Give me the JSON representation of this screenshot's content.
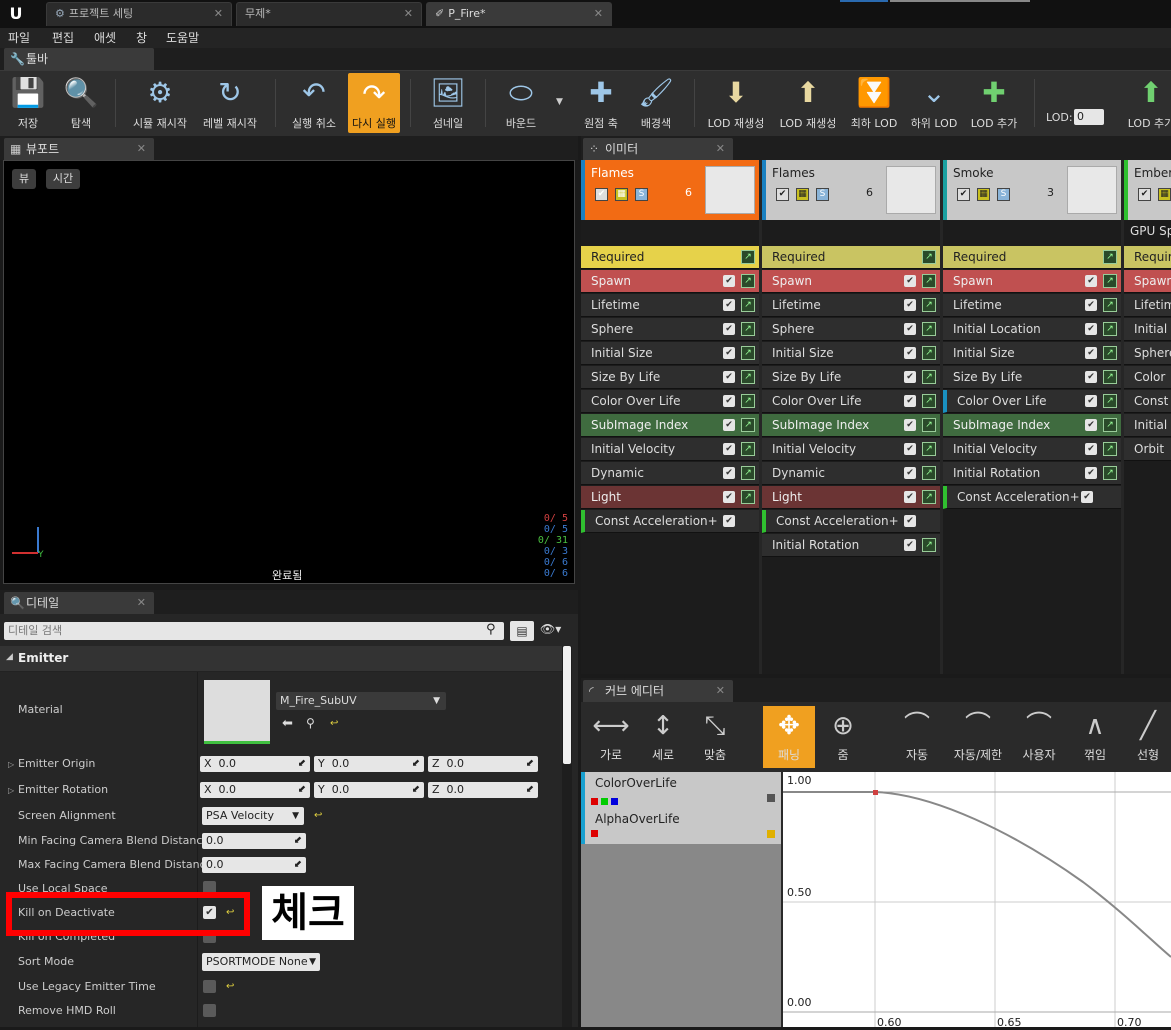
{
  "tabs": [
    {
      "label": "프로젝트 세팅"
    },
    {
      "label": "무제*"
    },
    {
      "label": "P_Fire*"
    }
  ],
  "menu": [
    "파일",
    "편집",
    "애셋",
    "창",
    "도움말"
  ],
  "toolbar_panel_title": "툴바",
  "toolbar": [
    {
      "label": "저장",
      "icon": "save-icon"
    },
    {
      "label": "탐색",
      "icon": "browse-icon"
    },
    {
      "label": "시뮬 재시작",
      "icon": "restart-sim-icon"
    },
    {
      "label": "레벨 재시작",
      "icon": "restart-level-icon"
    },
    {
      "label": "실행 취소",
      "icon": "undo-icon"
    },
    {
      "label": "다시 실행",
      "icon": "redo-icon"
    },
    {
      "label": "섬네일",
      "icon": "thumbnail-icon"
    },
    {
      "label": "바운드",
      "icon": "bounds-icon"
    },
    {
      "label": "원점 축",
      "icon": "origin-axis-icon"
    },
    {
      "label": "배경색",
      "icon": "background-color-icon"
    },
    {
      "label": "LOD 재생성",
      "icon": "regen-lod-icon"
    },
    {
      "label": "LOD 재생성",
      "icon": "regen-lod-icon-2"
    },
    {
      "label": "최하 LOD",
      "icon": "lowest-lod-icon"
    },
    {
      "label": "하위 LOD",
      "icon": "lower-lod-icon"
    },
    {
      "label": "LOD 추가",
      "icon": "add-lod-icon"
    },
    {
      "label": "LOD 추가",
      "icon": "add-lod-icon-2"
    }
  ],
  "lod": {
    "label": "LOD:",
    "value": "0"
  },
  "viewport": {
    "title": "뷰포트",
    "view_btn": "뷰",
    "time_btn": "시간",
    "status": "완료됨",
    "stats": [
      "0/ 5",
      "0/ 5",
      "0/ 31",
      "0/ 3",
      "0/ 6",
      "0/ 6"
    ],
    "stat_colors": [
      "#d04040",
      "#3a7ad0",
      "#4ac040",
      "#3a7ad0",
      "#3a7ad0",
      "#3a7ad0"
    ]
  },
  "details": {
    "title": "디테일",
    "search_placeholder": "디테일 검색",
    "section": "Emitter",
    "material_label": "Material",
    "material_value": "M_Fire_SubUV",
    "emitter_origin": {
      "label": "Emitter Origin",
      "x": "0.0",
      "y": "0.0",
      "z": "0.0"
    },
    "emitter_rotation": {
      "label": "Emitter Rotation",
      "x": "0.0",
      "y": "0.0",
      "z": "0.0"
    },
    "screen_alignment": {
      "label": "Screen Alignment",
      "value": "PSA Velocity"
    },
    "min_facing": {
      "label": "Min Facing Camera Blend Distance",
      "value": "0.0"
    },
    "max_facing": {
      "label": "Max Facing Camera Blend Distance",
      "value": "0.0"
    },
    "use_local_space": {
      "label": "Use Local Space"
    },
    "kill_on_deactivate": {
      "label": "Kill on Deactivate"
    },
    "kill_on_completed": {
      "label": "Kill on Completed"
    },
    "sort_mode": {
      "label": "Sort Mode",
      "value": "PSORTMODE None"
    },
    "legacy_time": {
      "label": "Use Legacy Emitter Time"
    },
    "remove_hmd_roll": {
      "label": "Remove HMD Roll"
    },
    "annotation": "체크",
    "x_label": "X",
    "y_label": "Y",
    "z_label": "Z"
  },
  "emitters_panel": {
    "title": "이미터",
    "columns": [
      {
        "name": "Flames",
        "count": "6",
        "modules": [
          "Required",
          "Spawn",
          "Lifetime",
          "Sphere",
          "Initial Size",
          "Size By Life",
          "Color Over Life",
          "SubImage Index",
          "Initial Velocity",
          "Dynamic",
          "Light",
          "Const Acceleration+"
        ]
      },
      {
        "name": "Flames",
        "count": "6",
        "modules": [
          "Required",
          "Spawn",
          "Lifetime",
          "Sphere",
          "Initial Size",
          "Size By Life",
          "Color Over Life",
          "SubImage Index",
          "Initial Velocity",
          "Dynamic",
          "Light",
          "Const Acceleration+",
          "Initial Rotation"
        ]
      },
      {
        "name": "Smoke",
        "count": "3",
        "modules": [
          "Required",
          "Spawn",
          "Lifetime",
          "Initial Location",
          "Initial Size",
          "Size By Life",
          "Color Over Life",
          "SubImage Index",
          "Initial Velocity",
          "Initial Rotation",
          "Const Acceleration+"
        ]
      },
      {
        "name": "Ember",
        "count": "",
        "gpu": "GPU Sp",
        "modules": [
          "Requir",
          "Spawn",
          "Lifetim",
          "Initial S",
          "Sphere",
          "Color O",
          "Const A",
          "Initial V",
          "Orbit"
        ]
      }
    ]
  },
  "curve_editor": {
    "title": "커브 에디터",
    "buttons": [
      {
        "label": "가로",
        "icon": "horizontal-fit-icon"
      },
      {
        "label": "세로",
        "icon": "vertical-fit-icon"
      },
      {
        "label": "맞춤",
        "icon": "fit-icon"
      },
      {
        "label": "패닝",
        "icon": "pan-icon"
      },
      {
        "label": "줌",
        "icon": "zoom-icon"
      },
      {
        "label": "자동",
        "icon": "auto-tangent-icon"
      },
      {
        "label": "자동/제한",
        "icon": "auto-clamped-icon"
      },
      {
        "label": "사용자",
        "icon": "user-tangent-icon"
      },
      {
        "label": "꺾임",
        "icon": "break-tangent-icon"
      },
      {
        "label": "선형",
        "icon": "linear-icon"
      }
    ],
    "tracks": [
      "ColorOverLife",
      "AlphaOverLife"
    ],
    "y_ticks": [
      "1.00",
      "0.50",
      "0.00"
    ],
    "x_ticks": [
      "0.60",
      "0.65",
      "0.70"
    ]
  }
}
